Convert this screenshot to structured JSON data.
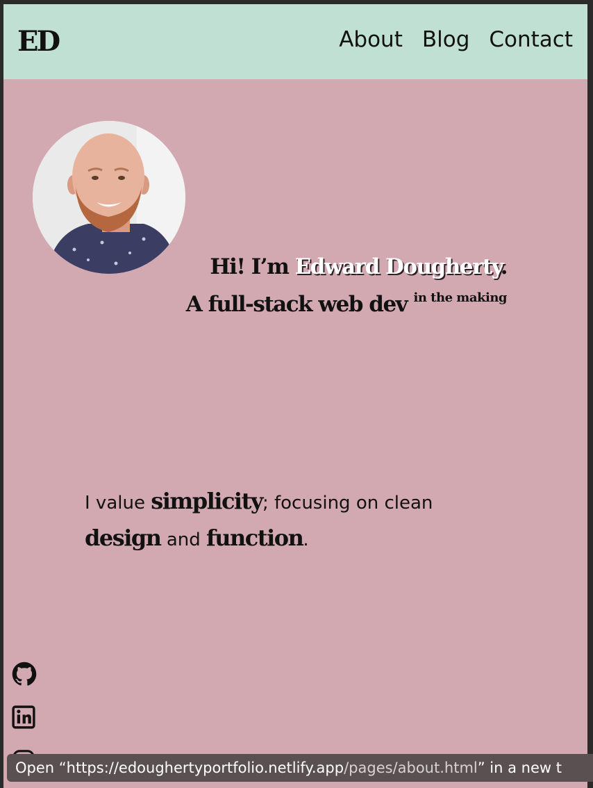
{
  "nav": {
    "logo": "ED",
    "links": [
      "About",
      "Blog",
      "Contact"
    ]
  },
  "hero": {
    "greeting": "Hi! I’m",
    "name": "Edward Dougherty",
    "period": ".",
    "role": "A full-stack web dev",
    "role_sup": "in the making"
  },
  "tagline": {
    "part1": "I value",
    "word1": "simplicity",
    "part2": "; focusing on clean",
    "word2": "design",
    "part3": "and",
    "word3": "function",
    "part4": "."
  },
  "social": {
    "icons": [
      "github-icon",
      "linkedin-icon",
      "instagram-icon"
    ]
  },
  "status_bar": {
    "prefix": "Open “https://edoughertyportfolio.netlify.app",
    "path": "/pages/about.html",
    "suffix": "” in a new t"
  },
  "colors": {
    "navbar_bg": "#bfe0d3",
    "page_bg": "#d2a8b1",
    "text": "#111111"
  }
}
